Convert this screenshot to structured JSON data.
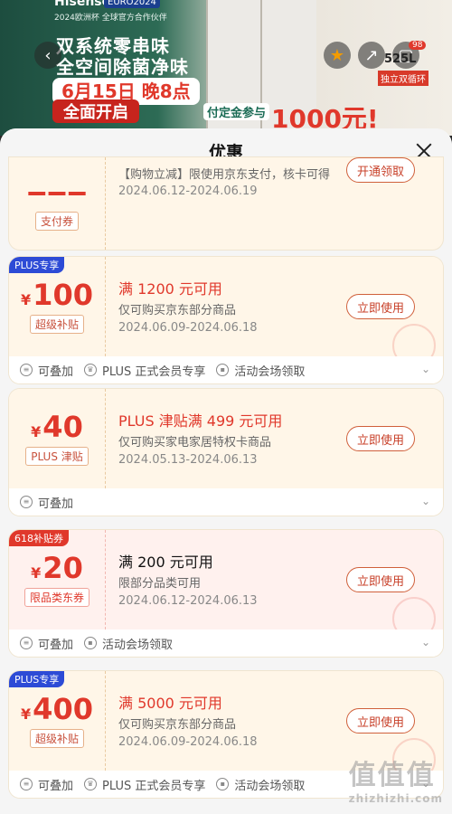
{
  "hero": {
    "brand": "Hisense",
    "euro": "EURO2024",
    "tagline": "2024欧洲杯 全球官方合作伙伴",
    "headline1": "双系统零串味",
    "headline2": "全空间除菌净味",
    "date_line1": "6月15日 晚8点",
    "date_line2": "全面开启",
    "deposit": "付定金参与",
    "big_offer": "1000元!",
    "cart_badge": "98",
    "volume": "525L",
    "tag": "独立双循环"
  },
  "sheet": {
    "title": "优惠"
  },
  "partial": {
    "type": "支付券",
    "scope": "【购物立减】限使用京东支付，核卡可得",
    "dates": "2024.06.12-2024.06.19",
    "button": "开通领取"
  },
  "coupons": [
    {
      "ribbon": "PLUS专享",
      "amount": "100",
      "type": "超级补贴",
      "condition": "满 1200 元可用",
      "scope": "仅可购买京东部分商品",
      "dates": "2024.06.09-2024.06.18",
      "button": "立即使用",
      "meta": [
        "可叠加",
        "PLUS 正式会员专享",
        "活动会场领取"
      ]
    },
    {
      "ribbon": "",
      "amount": "40",
      "type": "PLUS 津贴",
      "condition": "PLUS 津贴满 499 元可用",
      "scope": "仅可购买家电家居特权卡商品",
      "dates": "2024.05.13-2024.06.13",
      "button": "立即使用",
      "meta": [
        "可叠加"
      ]
    },
    {
      "ribbon": "618补贴券",
      "amount": "20",
      "type": "限品类东券",
      "condition": "满 200 元可用",
      "scope": "限部分品类可用",
      "dates": "2024.06.12-2024.06.13",
      "button": "立即使用",
      "meta": [
        "可叠加",
        "活动会场领取"
      ]
    },
    {
      "ribbon": "PLUS专享",
      "amount": "400",
      "type": "超级补贴",
      "condition": "满 5000 元可用",
      "scope": "仅可购买京东部分商品",
      "dates": "2024.06.09-2024.06.18",
      "button": "立即使用",
      "meta": [
        "可叠加",
        "PLUS 正式会员专享",
        "活动会场领取"
      ]
    }
  ],
  "currency": "¥",
  "watermark": {
    "main": "值值值",
    "sub": "zhizhizhi.com"
  },
  "colors": {
    "accent_red": "#e0382b",
    "plus_blue": "#2d4bd6",
    "coupon_bg": "#fff6e8",
    "coupon_bg_red": "#fff1ee"
  }
}
